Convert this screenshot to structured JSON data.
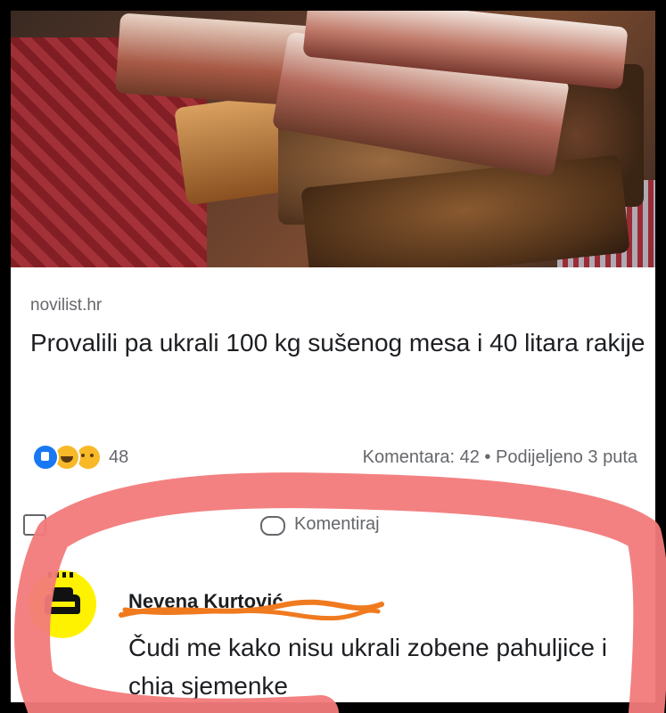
{
  "post": {
    "source": "novilist.hr",
    "headline": "Provalili pa ukrali 100 kg sušenog mesa i 40 litara rakije",
    "reaction_count": "48",
    "comments_shares": "Komentara: 42 • Podijeljeno 3 puta",
    "comment_action": "Komentiraj"
  },
  "comment": {
    "author": "Nevena Kurtović",
    "text": "Čudi me kako nisu ukrali zobene pahuljice i chia sjemenke"
  },
  "colors": {
    "highlight_circle": "#f27a7a",
    "scribble": "#f07a1e",
    "link_gray": "#65676b"
  }
}
